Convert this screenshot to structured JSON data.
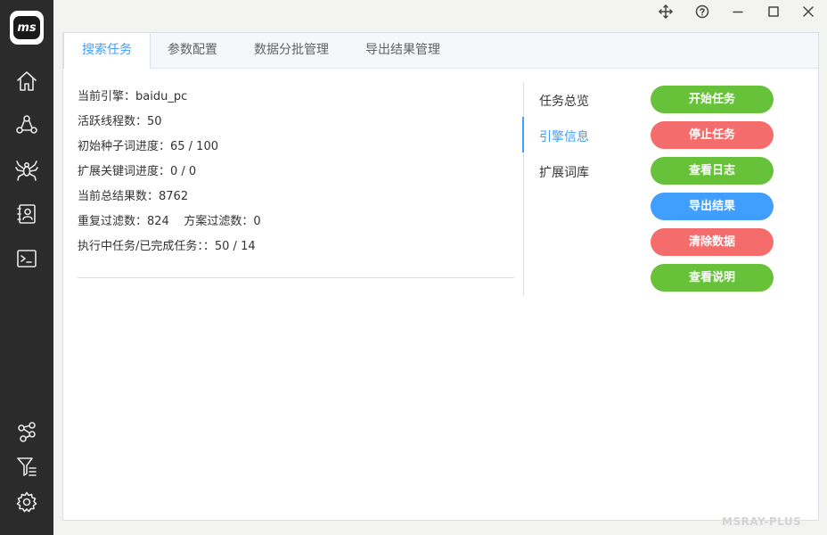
{
  "app": {
    "logo_text": "ms",
    "watermark": "MSRAY-PLUS"
  },
  "sidebar": {
    "items": [
      {
        "name": "home-icon"
      },
      {
        "name": "network-icon"
      },
      {
        "name": "spider-icon"
      },
      {
        "name": "contacts-icon"
      },
      {
        "name": "terminal-icon"
      },
      {
        "name": "share-icon"
      },
      {
        "name": "filter-icon"
      },
      {
        "name": "settings-icon"
      }
    ]
  },
  "window_controls": {
    "move": "move-icon",
    "help": "help-icon",
    "minimize": "minimize-icon",
    "maximize": "maximize-icon",
    "close": "close-icon"
  },
  "tabs": [
    {
      "label": "搜索任务",
      "active": true
    },
    {
      "label": "参数配置",
      "active": false
    },
    {
      "label": "数据分批管理",
      "active": false
    },
    {
      "label": "导出结果管理",
      "active": false
    }
  ],
  "info": {
    "line1": "当前引擎：baidu_pc",
    "line2": "活跃线程数：50",
    "line3": "初始种子词进度：65 / 100",
    "line4": "扩展关键词进度：0 / 0",
    "line5": "当前总结果数：8762",
    "line6": "重复过滤数：824    方案过滤数：0",
    "line7": "执行中任务/已完成任务：：50 / 14"
  },
  "side_tabs": [
    {
      "label": "任务总览",
      "active": false
    },
    {
      "label": "引擎信息",
      "active": true
    },
    {
      "label": "扩展词库",
      "active": false
    }
  ],
  "buttons": {
    "start": "开始任务",
    "stop": "停止任务",
    "log": "查看日志",
    "export": "导出结果",
    "clear": "清除数据",
    "help": "查看说明"
  }
}
